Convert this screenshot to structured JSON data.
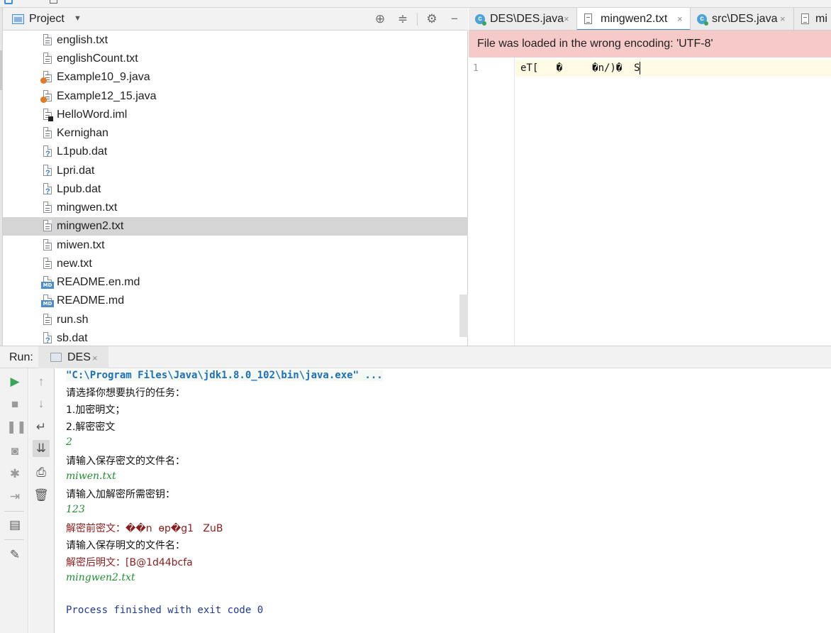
{
  "colors": {
    "selection_row": "#d5d5d5",
    "encoding_banner": "#f7caca",
    "active_tab_underline": "#4a86c8",
    "console_input": "#1d8f2f",
    "console_error": "#8b1c1c",
    "console_exit": "#1f3b8f",
    "run_green": "#3aa55a"
  },
  "project_panel": {
    "title": "Project",
    "title_icon": "project-icon",
    "caret_icon": "chevron-down-icon",
    "header_buttons": [
      "locate-icon",
      "collapse-icon",
      "gear-icon",
      "hide-icon"
    ],
    "files": [
      {
        "name": "english.txt",
        "icon": "text-file-icon"
      },
      {
        "name": "englishCount.txt",
        "icon": "text-file-icon"
      },
      {
        "name": "Example10_9.java",
        "icon": "java-file-icon"
      },
      {
        "name": "Example12_15.java",
        "icon": "java-file-icon"
      },
      {
        "name": "HelloWord.iml",
        "icon": "iml-file-icon"
      },
      {
        "name": "Kernighan",
        "icon": "text-file-icon"
      },
      {
        "name": "L1pub.dat",
        "icon": "unknown-file-icon"
      },
      {
        "name": "Lpri.dat",
        "icon": "unknown-file-icon"
      },
      {
        "name": "Lpub.dat",
        "icon": "unknown-file-icon"
      },
      {
        "name": "mingwen.txt",
        "icon": "text-file-icon"
      },
      {
        "name": "mingwen2.txt",
        "icon": "text-file-icon",
        "selected": true
      },
      {
        "name": "miwen.txt",
        "icon": "text-file-icon"
      },
      {
        "name": "new.txt",
        "icon": "text-file-icon"
      },
      {
        "name": "README.en.md",
        "icon": "markdown-file-icon"
      },
      {
        "name": "README.md",
        "icon": "markdown-file-icon"
      },
      {
        "name": "run.sh",
        "icon": "text-file-icon"
      },
      {
        "name": "sb.dat",
        "icon": "unknown-file-icon"
      }
    ]
  },
  "editor": {
    "tabs": [
      {
        "label": "DES\\DES.java",
        "icon": "java-class-icon",
        "active": false
      },
      {
        "label": "mingwen2.txt",
        "icon": "text-file-icon",
        "active": true
      },
      {
        "label": "src\\DES.java",
        "icon": "java-class-icon",
        "active": false
      },
      {
        "label": "mi",
        "icon": "text-file-icon",
        "active": false
      }
    ],
    "close_glyph": "×",
    "encoding_warning": "File was loaded in the wrong encoding: 'UTF-8'",
    "line_number": "1",
    "line_text": "eT[   �     �n/)�  S"
  },
  "run_panel": {
    "label": "Run:",
    "tab_label": "DES",
    "tab_close": "×",
    "left_toolbar": [
      "run-icon",
      "stop-icon",
      "pause-icon",
      "camera-icon",
      "debug-icon",
      "exit-icon",
      "layout-icon",
      "pin-icon"
    ],
    "right_toolbar": [
      "up-arrow-icon",
      "down-arrow-icon",
      "soft-wrap-icon",
      "scroll-to-end-icon",
      "print-icon",
      "trash-icon"
    ],
    "console_lines": [
      {
        "type": "cmd",
        "text": "\"C:\\Program Files\\Java\\jdk1.8.0_102\\bin\\java.exe\" ..."
      },
      {
        "type": "out",
        "text": "请选择你想要执行的任务："
      },
      {
        "type": "out",
        "text": "1.加密明文；"
      },
      {
        "type": "out",
        "text": "2.解密密文"
      },
      {
        "type": "in",
        "text": "2"
      },
      {
        "type": "out",
        "text": "请输入保存密文的文件名："
      },
      {
        "type": "in",
        "text": "miwen.txt"
      },
      {
        "type": "out",
        "text": "请输入加解密所需密钥："
      },
      {
        "type": "in",
        "text": "123"
      },
      {
        "type": "err",
        "text": "解密前密文：��n  ɵp�g1   ZuB"
      },
      {
        "type": "out",
        "text": "请输入保存明文的文件名："
      },
      {
        "type": "err",
        "text": "解密后明文：[B@1d44bcfa"
      },
      {
        "type": "in",
        "text": "mingwen2.txt"
      },
      {
        "type": "blank",
        "text": ""
      },
      {
        "type": "exit",
        "text": "Process finished with exit code 0"
      }
    ]
  }
}
